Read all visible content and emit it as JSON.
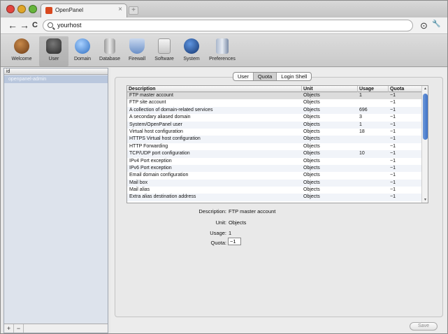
{
  "browser": {
    "tab_title": "OpenPanel",
    "tab_close": "×",
    "new_tab": "+",
    "address": "yourhost",
    "nav": {
      "back": "←",
      "forward": "→",
      "reload": "C"
    },
    "right_icons": {
      "stop": "⊙",
      "wrench": "🔧"
    }
  },
  "toolbar": {
    "items": [
      {
        "label": "Welcome",
        "icon": "welcome-icon",
        "color": "#7a4b22"
      },
      {
        "label": "User",
        "icon": "user-icon",
        "color": "#3d3d3d",
        "selected": true
      },
      {
        "label": "Domain",
        "icon": "globe-icon",
        "color": "#3f7fd0"
      },
      {
        "label": "Database",
        "icon": "database-icon",
        "color": "#9a9a9a"
      },
      {
        "label": "Firewall",
        "icon": "shield-icon",
        "color": "#6a8fc7"
      },
      {
        "label": "Software",
        "icon": "software-icon",
        "color": "#5aa34a"
      },
      {
        "label": "System",
        "icon": "system-icon",
        "color": "#2f5fa5"
      },
      {
        "label": "Preferences",
        "icon": "preferences-icon",
        "color": "#7c8da8"
      }
    ]
  },
  "sidebar": {
    "header": "id",
    "items": [
      {
        "label": "openpanel-admin"
      }
    ],
    "add": "+",
    "remove": "−"
  },
  "tabs": [
    {
      "label": "User"
    },
    {
      "label": "Quota",
      "selected": true
    },
    {
      "label": "Login Shell"
    }
  ],
  "table": {
    "columns": [
      "Description",
      "Unit",
      "Usage",
      "Quota"
    ],
    "rows": [
      [
        "FTP master account",
        "Objects",
        "1",
        "−1"
      ],
      [
        "FTP site account",
        "Objects",
        "",
        "−1"
      ],
      [
        "A collection of domain-related services",
        "Objects",
        "696",
        "−1"
      ],
      [
        "A secondary aliased domain",
        "Objects",
        "3",
        "−1"
      ],
      [
        "System/OpenPanel user",
        "Objects",
        "1",
        "−1"
      ],
      [
        "Virtual host configuration",
        "Objects",
        "18",
        "−1"
      ],
      [
        "HTTPS Virtual host configuration",
        "Objects",
        "",
        "−1"
      ],
      [
        "HTTP Forwarding",
        "Objects",
        "",
        "−1"
      ],
      [
        "TCP/UDP port configuration",
        "Objects",
        "10",
        "−1"
      ],
      [
        "IPv4 Port exception",
        "Objects",
        "",
        "−1"
      ],
      [
        "IPv6 Port exception",
        "Objects",
        "",
        "−1"
      ],
      [
        "Email domain configuration",
        "Objects",
        "",
        "−1"
      ],
      [
        "Mail box",
        "Objects",
        "",
        "−1"
      ],
      [
        "Mail alias",
        "Objects",
        "",
        "−1"
      ],
      [
        "Extra alias destination address",
        "Objects",
        "",
        "−1"
      ]
    ]
  },
  "details": {
    "description_label": "Description:",
    "description_value": "FTP master account",
    "unit_label": "Unit:",
    "unit_value": "Objects",
    "usage_label": "Usage:",
    "usage_value": "1",
    "quota_label": "Quota:",
    "quota_value": "−1"
  },
  "save_label": "Save"
}
